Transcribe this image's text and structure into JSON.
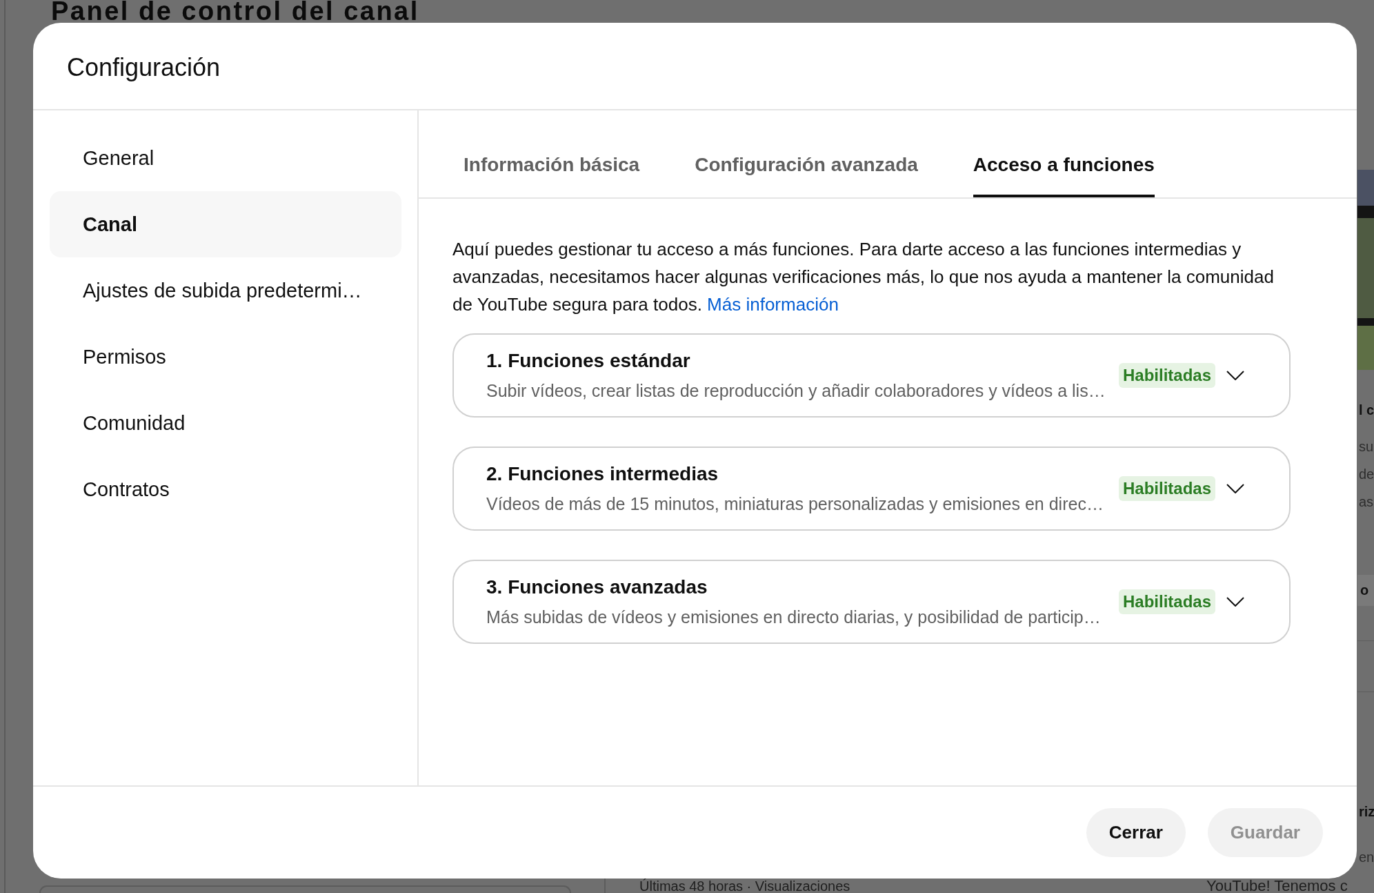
{
  "background_page": {
    "title": "Panel de control del canal",
    "right_column": {
      "block_1": [
        {
          "kind": "heading",
          "text": "l c"
        },
        {
          "kind": "text",
          "text": "su"
        },
        {
          "kind": "text",
          "text": "de"
        },
        {
          "kind": "text",
          "text": "as"
        }
      ],
      "button": "o",
      "block_2": [
        {
          "kind": "heading",
          "text": "riz"
        },
        {
          "kind": "text",
          "text": "en"
        }
      ]
    },
    "bottom_caption": "Últimas 48 horas · Visualizaciones",
    "bottom_text": "YouTube! Tenemos c"
  },
  "dialog": {
    "title": "Configuración",
    "sidebar": {
      "items": [
        {
          "label": "General",
          "selected": false
        },
        {
          "label": "Canal",
          "selected": true
        },
        {
          "label": "Ajustes de subida predetermi…",
          "selected": false
        },
        {
          "label": "Permisos",
          "selected": false
        },
        {
          "label": "Comunidad",
          "selected": false
        },
        {
          "label": "Contratos",
          "selected": false
        }
      ]
    },
    "tabs": [
      {
        "label": "Información básica",
        "selected": false
      },
      {
        "label": "Configuración avanzada",
        "selected": false
      },
      {
        "label": "Acceso a funciones",
        "selected": true
      }
    ],
    "description": {
      "text": "Aquí puedes gestionar tu acceso a más funciones. Para darte acceso a las funciones intermedias y avanzadas, necesitamos hacer algunas verificaciones más, lo que nos ayuda a mantener la comunidad de YouTube segura para todos.",
      "link": "Más información"
    },
    "features": [
      {
        "title": "1. Funciones estándar",
        "description": "Subir vídeos, crear listas de reproducción y añadir colaboradores y vídeos a lis…",
        "status": "Habilitadas",
        "expanded": false
      },
      {
        "title": "2. Funciones intermedias",
        "description": "Vídeos de más de 15 minutos, miniaturas personalizadas y emisiones en direc…",
        "status": "Habilitadas",
        "expanded": false
      },
      {
        "title": "3. Funciones avanzadas",
        "description": "Más subidas de vídeos y emisiones en directo diarias, y posibilidad de particip…",
        "status": "Habilitadas",
        "expanded": false
      }
    ],
    "buttons": [
      {
        "label": "Cerrar",
        "disabled": false
      },
      {
        "label": "Guardar",
        "disabled": true
      }
    ]
  }
}
